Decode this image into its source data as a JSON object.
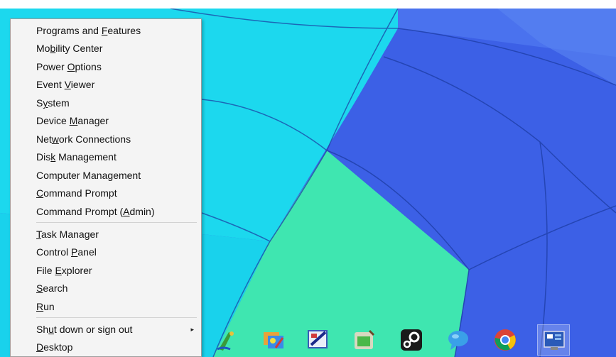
{
  "menu": {
    "items": [
      {
        "pre": "Programs and ",
        "key": "F",
        "post": "eatures"
      },
      {
        "pre": "Mo",
        "key": "b",
        "post": "ility Center"
      },
      {
        "pre": "Power ",
        "key": "O",
        "post": "ptions"
      },
      {
        "pre": "Event ",
        "key": "V",
        "post": "iewer"
      },
      {
        "pre": "S",
        "key": "y",
        "post": "stem"
      },
      {
        "pre": "Device ",
        "key": "M",
        "post": "anager"
      },
      {
        "pre": "Net",
        "key": "w",
        "post": "ork Connections"
      },
      {
        "pre": "Dis",
        "key": "k",
        "post": " Management"
      },
      {
        "pre": "Computer Mana",
        "key": "g",
        "post": "ement"
      },
      {
        "pre": "",
        "key": "C",
        "post": "ommand Prompt"
      },
      {
        "pre": "Command Prompt (",
        "key": "A",
        "post": "dmin)"
      },
      {
        "pre": "",
        "key": "T",
        "post": "ask Manager"
      },
      {
        "pre": "Control ",
        "key": "P",
        "post": "anel"
      },
      {
        "pre": "File ",
        "key": "E",
        "post": "xplorer"
      },
      {
        "pre": "",
        "key": "S",
        "post": "earch"
      },
      {
        "pre": "",
        "key": "R",
        "post": "un"
      },
      {
        "pre": "Sh",
        "key": "u",
        "post": "t down or sign out"
      },
      {
        "pre": "",
        "key": "D",
        "post": "esktop"
      }
    ],
    "submenu_arrow": "▸"
  },
  "taskbar": {
    "icons": [
      "paint-icon",
      "photo-gallery-icon",
      "paint-net-icon",
      "game-launcher-icon",
      "steam-icon",
      "messenger-icon",
      "chrome-icon",
      "control-panel-icon"
    ]
  },
  "colors": {
    "menu_bg": "#f4f4f4",
    "wallpaper_cyan": "#18dcf0",
    "wallpaper_blue": "#3a5ee8",
    "wallpaper_mint": "#3ff0b8"
  }
}
